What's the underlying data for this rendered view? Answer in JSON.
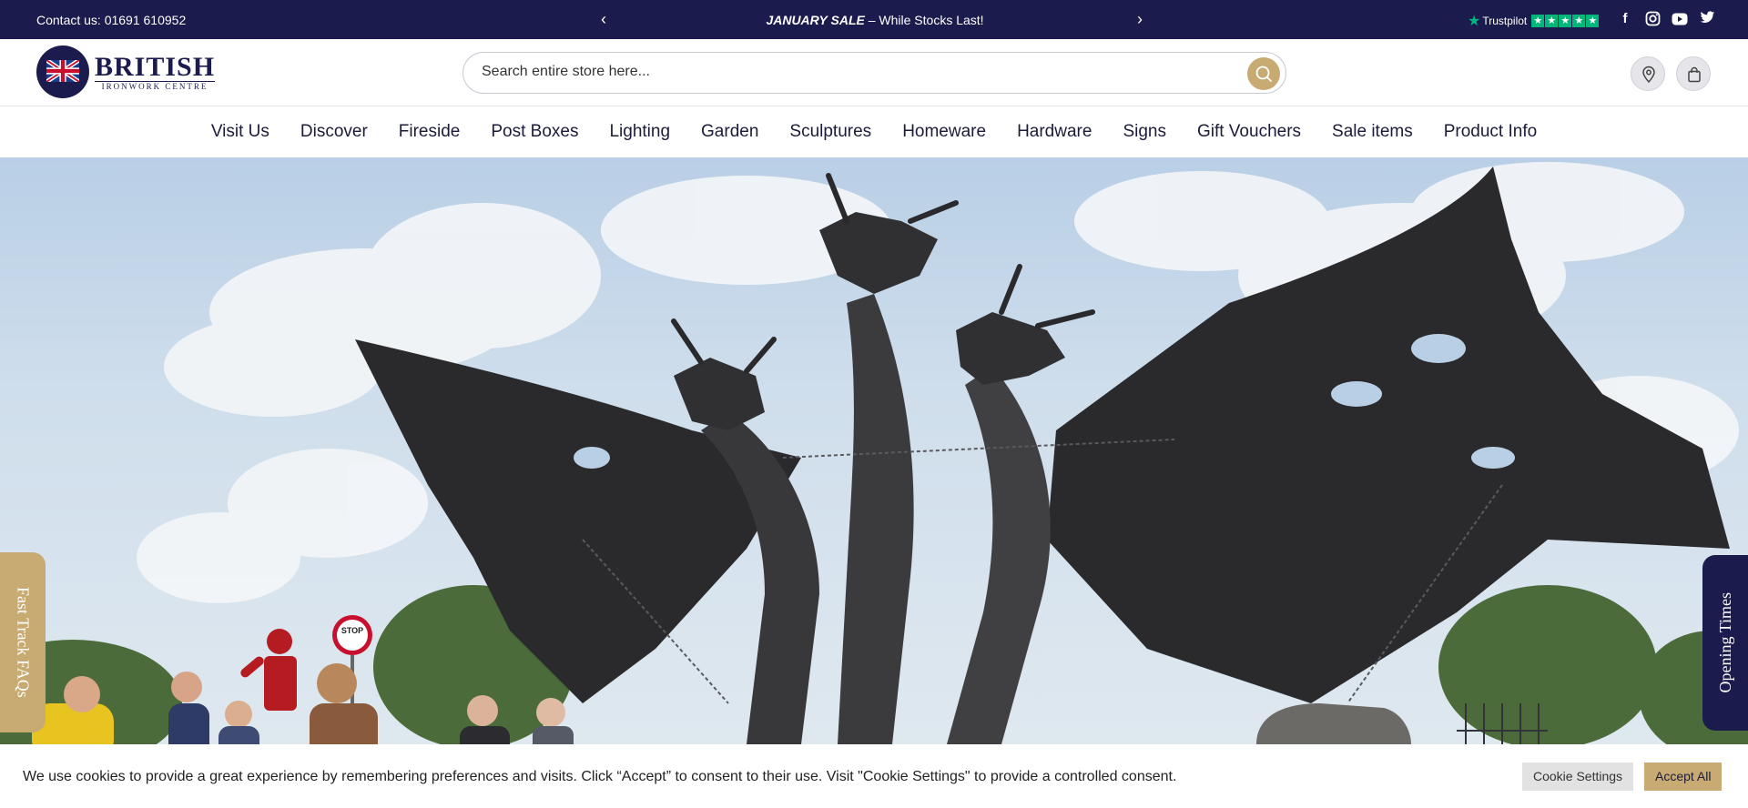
{
  "topbar": {
    "contact": "Contact us: 01691 610952",
    "prev_arrow": "‹",
    "next_arrow": "›",
    "promo_bold": "JANUARY SALE",
    "promo_rest": " – While Stocks Last!",
    "trustpilot_label": "Trustpilot",
    "trustpilot_rating_stars": 5,
    "socials": [
      "facebook-icon",
      "instagram-icon",
      "youtube-icon",
      "twitter-icon"
    ]
  },
  "header": {
    "logo_line1": "BRITISH",
    "logo_line2": "IRONWORK CENTRE",
    "search_placeholder": "Search entire store here...",
    "icons": [
      "location-pin-icon",
      "shopping-bag-icon"
    ]
  },
  "nav": {
    "items": [
      "Visit Us",
      "Discover",
      "Fireside",
      "Post Boxes",
      "Lighting",
      "Garden",
      "Sculptures",
      "Homeware",
      "Hardware",
      "Signs",
      "Gift Vouchers",
      "Sale items",
      "Product Info"
    ]
  },
  "hero": {
    "left_tab": "Fast Track FAQs",
    "right_tab": "Opening Times",
    "sign_text": "STOP"
  },
  "cookie": {
    "message": "We use cookies to provide a great experience by remembering preferences and visits. Click “Accept” to consent to their use. Visit \"Cookie Settings\" to provide a controlled consent.",
    "settings_label": "Cookie Settings",
    "accept_label": "Accept All"
  },
  "colors": {
    "navy": "#1c1b4d",
    "gold": "#c8ab72",
    "trustpilot_green": "#00b67a"
  }
}
